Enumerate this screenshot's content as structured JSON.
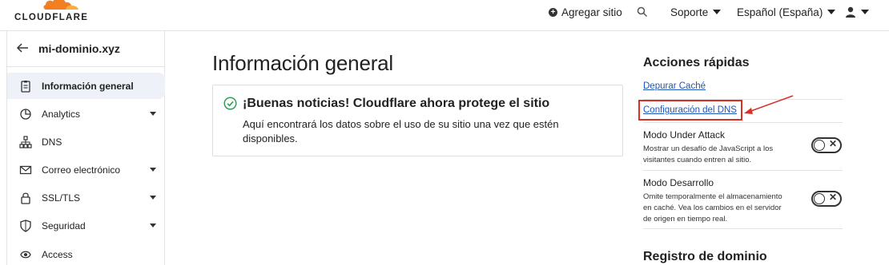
{
  "header": {
    "logo_text": "CLOUDFLARE",
    "add_site_label": "Agregar sitio",
    "support_label": "Soporte",
    "language_label": "Español (España)"
  },
  "sidebar": {
    "site_name": "mi-dominio.xyz",
    "items": [
      {
        "label": "Información general",
        "icon": "clipboard-icon",
        "active": true,
        "has_caret": false
      },
      {
        "label": "Analytics",
        "icon": "chart-pie-icon",
        "active": false,
        "has_caret": true
      },
      {
        "label": "DNS",
        "icon": "network-icon",
        "active": false,
        "has_caret": false
      },
      {
        "label": "Correo electrónico",
        "icon": "email-icon",
        "active": false,
        "has_caret": true
      },
      {
        "label": "SSL/TLS",
        "icon": "lock-icon",
        "active": false,
        "has_caret": true
      },
      {
        "label": "Seguridad",
        "icon": "shield-icon",
        "active": false,
        "has_caret": true
      },
      {
        "label": "Access",
        "icon": "access-icon",
        "active": false,
        "has_caret": false
      }
    ]
  },
  "main": {
    "title": "Información general",
    "notice": {
      "title": "¡Buenas noticias! Cloudflare ahora protege el sitio",
      "body": "Aquí encontrará los datos sobre el uso de su sitio una vez que estén disponibles."
    }
  },
  "quick_actions": {
    "title": "Acciones rápidas",
    "purge_cache_label": "Depurar Caché",
    "dns_config_label": "Configuración del DNS",
    "under_attack": {
      "title": "Modo Under Attack",
      "description": "Mostrar un desafío de JavaScript a los visitantes cuando entren al sitio.",
      "enabled": false
    },
    "dev_mode": {
      "title": "Modo Desarrollo",
      "description": "Omite temporalmente el almacenamiento en caché. Vea los cambios en el servidor de origen en tiempo real.",
      "enabled": false
    },
    "domain_registration_title": "Registro de dominio"
  },
  "colors": {
    "brand_orange": "#f38020",
    "link_blue": "#1b56b8",
    "highlight_red": "#d93025",
    "success_green": "#2e9e5b"
  }
}
